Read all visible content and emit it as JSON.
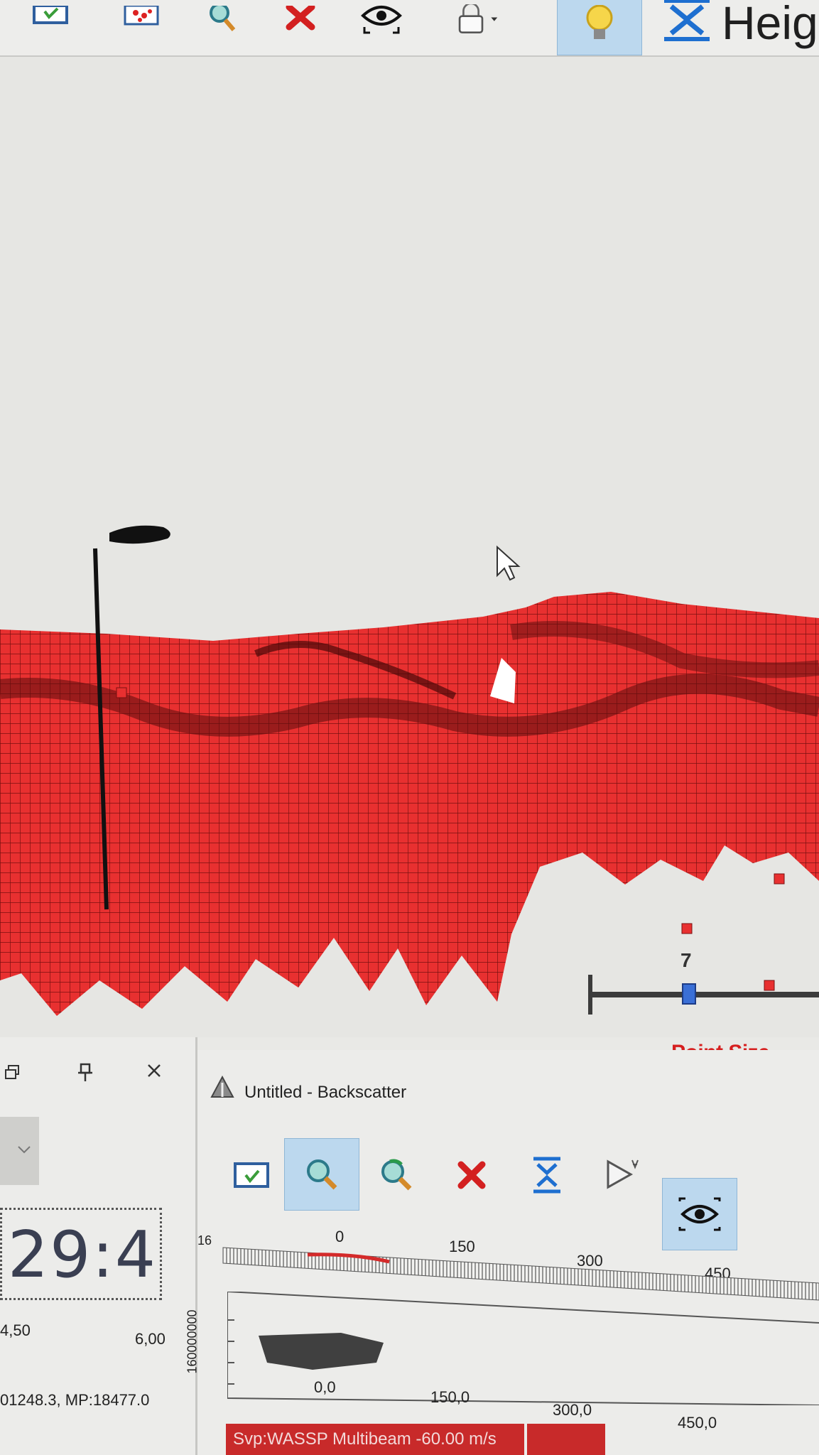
{
  "toolbar": {
    "height_label": "Heig"
  },
  "view3d": {
    "slider_value": "7",
    "point_size_label": "Point Size"
  },
  "left_panel": {
    "clock_text": "29:4",
    "axis_labels": [
      "4,50",
      "6,00"
    ],
    "status_text": "01248.3, MP:18477.0"
  },
  "backscatter": {
    "title": "Untitled - Backscatter",
    "top_scale": [
      "0",
      "150",
      "300",
      "450"
    ],
    "top_left_num": "16",
    "side_label": "160000000",
    "bottom_scale": [
      "0,0",
      "150,0",
      "300,0",
      "450,0"
    ]
  },
  "statusbar": {
    "svp_text": "Svp:WASSP Multibeam -60.00 m/s"
  },
  "colors": {
    "point_red": "#e02a2a",
    "active_button": "#bcd8ee"
  }
}
